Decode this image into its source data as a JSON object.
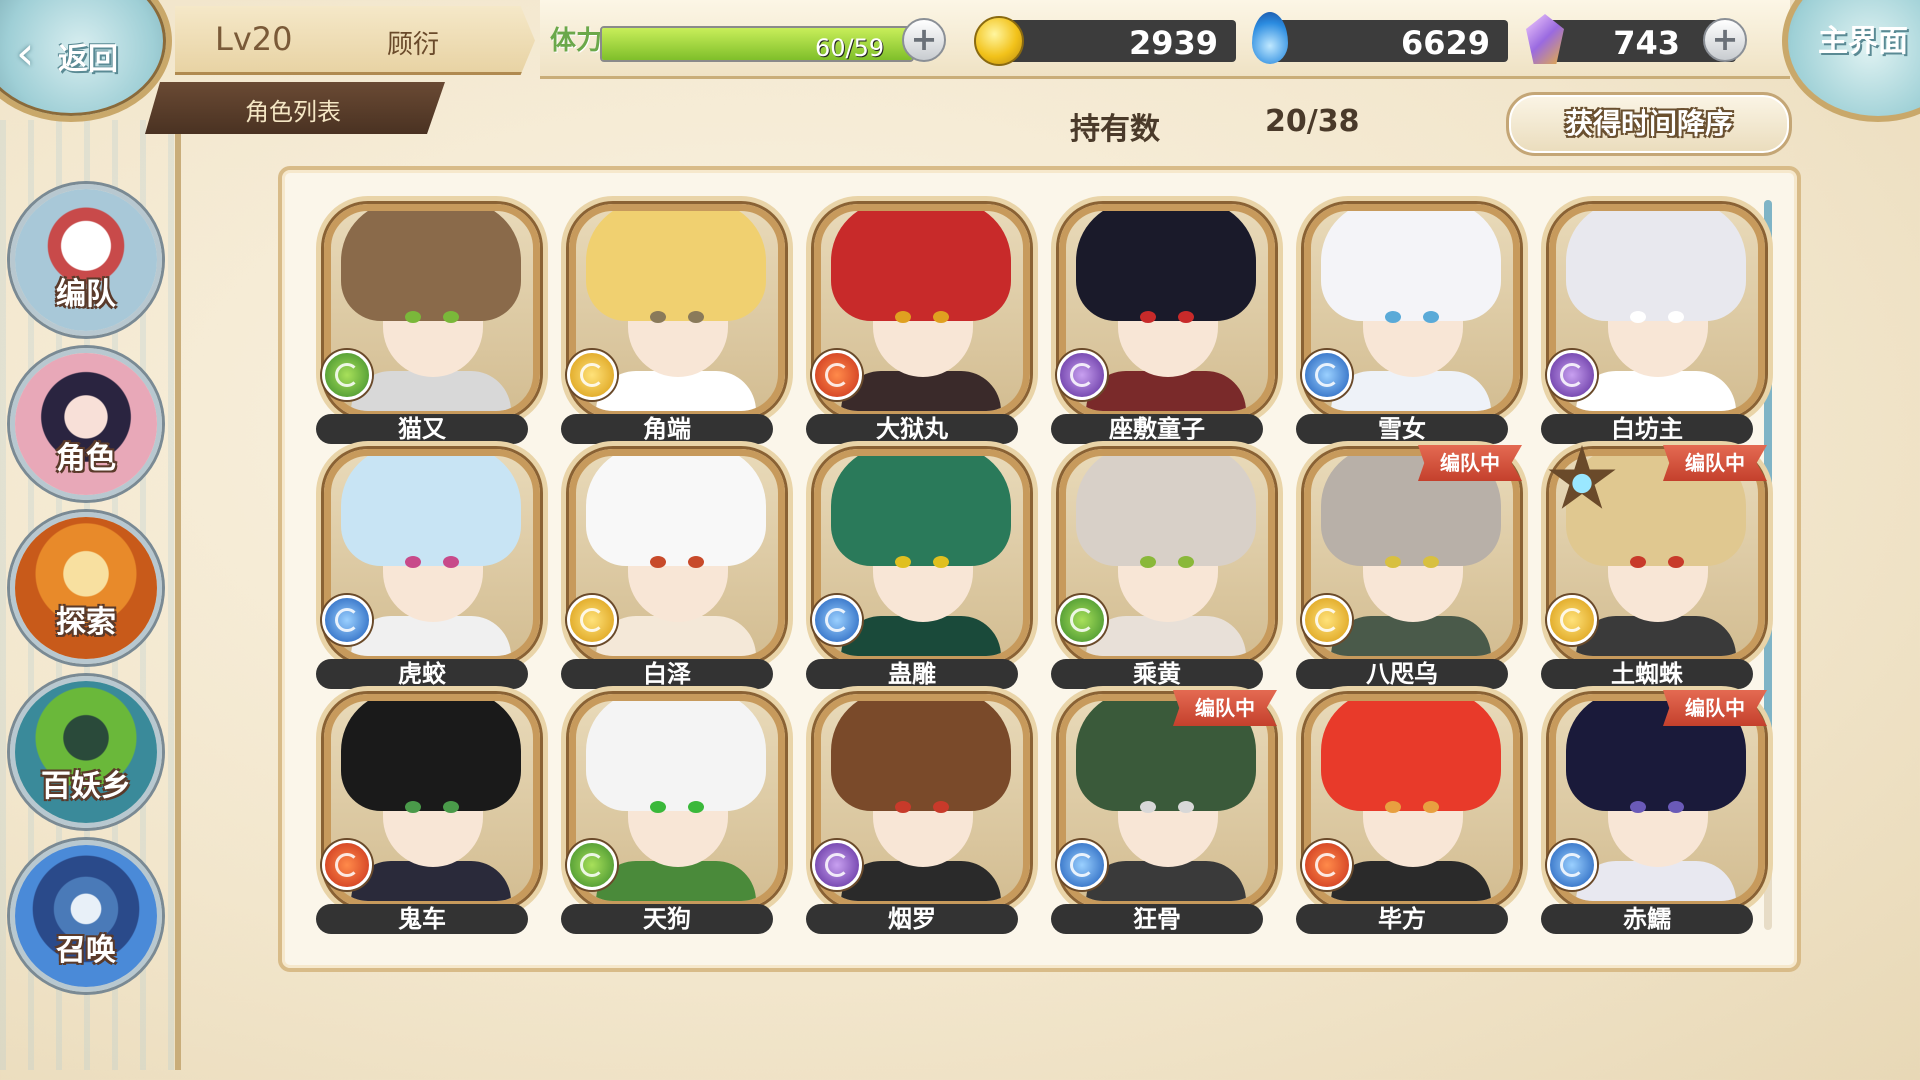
{
  "header": {
    "back_label": "返回",
    "level": "Lv20",
    "player_name": "顾衍",
    "section_title": "角色列表",
    "home_label": "主界面"
  },
  "resources": {
    "stamina_label": "体力",
    "stamina_text": "60/59",
    "stamina_fill_fraction": 1.0,
    "coins": "2939",
    "souls": "6629",
    "gems": "743"
  },
  "collection": {
    "owned_label": "持有数",
    "owned_value": "20/38",
    "sort_label": "获得时间降序"
  },
  "sidebar": {
    "items": [
      {
        "label": "编队",
        "icon": "formation-icon"
      },
      {
        "label": "角色",
        "icon": "character-icon"
      },
      {
        "label": "探索",
        "icon": "explore-icon"
      },
      {
        "label": "百妖乡",
        "icon": "village-icon"
      },
      {
        "label": "召唤",
        "icon": "summon-icon"
      }
    ]
  },
  "team_badge_label": "编队中",
  "characters": [
    {
      "name": "猫又",
      "element": "wind",
      "hair": "#8a6a4a",
      "eye": "#7ab83a",
      "outfit": "#d8d8d8",
      "in_team": false
    },
    {
      "name": "角端",
      "element": "light",
      "hair": "#f0d070",
      "eye": "#8a7a5a",
      "outfit": "#ffffff",
      "in_team": false
    },
    {
      "name": "大狱丸",
      "element": "fire",
      "hair": "#c82a2a",
      "eye": "#e0a020",
      "outfit": "#3a2a2a",
      "in_team": false
    },
    {
      "name": "座敷童子",
      "element": "dark",
      "hair": "#1a1a2a",
      "eye": "#c82a2a",
      "outfit": "#7a2a2a",
      "in_team": false
    },
    {
      "name": "雪女",
      "element": "water",
      "hair": "#f4f4f8",
      "eye": "#5aaad8",
      "outfit": "#eef2f8",
      "in_team": false
    },
    {
      "name": "白坊主",
      "element": "dark",
      "hair": "#e8e8ee",
      "eye": "#ffffff",
      "outfit": "#ffffff",
      "in_team": false
    },
    {
      "name": "虎蛟",
      "element": "water",
      "hair": "#c8e4f4",
      "eye": "#c84a8a",
      "outfit": "#f0f0f0",
      "in_team": false
    },
    {
      "name": "白泽",
      "element": "light",
      "hair": "#f8f8f8",
      "eye": "#c84a2a",
      "outfit": "#f4e8d8",
      "in_team": false
    },
    {
      "name": "蛊雕",
      "element": "water",
      "hair": "#2a7a5a",
      "eye": "#e0c020",
      "outfit": "#1a4a3a",
      "in_team": false
    },
    {
      "name": "乘黄",
      "element": "wind",
      "hair": "#d8d0c8",
      "eye": "#8ab83a",
      "outfit": "#e8e0d8",
      "in_team": false
    },
    {
      "name": "八咫乌",
      "element": "light",
      "hair": "#b8b0a8",
      "eye": "#d8c040",
      "outfit": "#4a5a4a",
      "in_team": true
    },
    {
      "name": "土蜘蛛",
      "element": "light",
      "hair": "#e0c890",
      "eye": "#c83a2a",
      "outfit": "#3a3a3a",
      "in_team": true,
      "starred": true
    },
    {
      "name": "鬼车",
      "element": "fire",
      "hair": "#1a1a1a",
      "eye": "#4a9a4a",
      "outfit": "#2a2a3a",
      "in_team": false
    },
    {
      "name": "天狗",
      "element": "wind",
      "hair": "#f4f4f4",
      "eye": "#3ab83a",
      "outfit": "#4a8a3a",
      "in_team": false
    },
    {
      "name": "烟罗",
      "element": "dark",
      "hair": "#7a4a2a",
      "eye": "#c83a2a",
      "outfit": "#2a2a2a",
      "in_team": false
    },
    {
      "name": "狂骨",
      "element": "water",
      "hair": "#3a5a3a",
      "eye": "#d8d8d8",
      "outfit": "#3a3a3a",
      "in_team": true
    },
    {
      "name": "毕方",
      "element": "fire",
      "hair": "#e83a2a",
      "eye": "#e8a040",
      "outfit": "#2a2a2a",
      "in_team": false
    },
    {
      "name": "赤鱬",
      "element": "water",
      "hair": "#1a1a3a",
      "eye": "#6a5ab8",
      "outfit": "#e8e8f0",
      "in_team": true
    }
  ]
}
